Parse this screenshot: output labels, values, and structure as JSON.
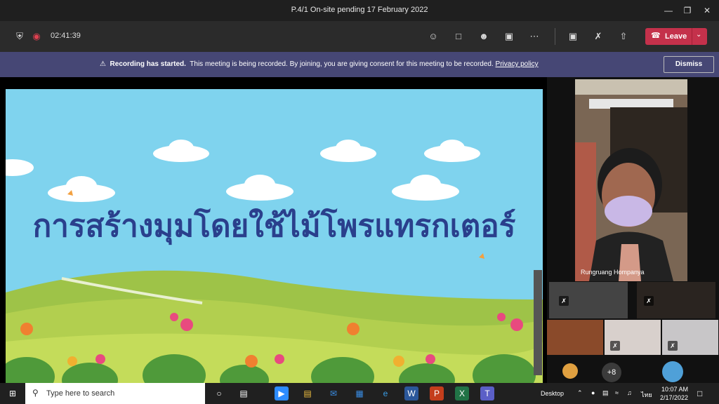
{
  "window": {
    "title": "P.4/1 On-site pending 17 February 2022"
  },
  "toolbar": {
    "timer": "02:41:39",
    "leave_label": "Leave",
    "icons": [
      "shield-icon",
      "record-icon",
      "people-icon",
      "chat-icon",
      "reactions-icon",
      "rooms-icon",
      "more-icon",
      "camera-off-icon",
      "mic-off-icon",
      "share-icon"
    ]
  },
  "banner": {
    "bold": "Recording has started.",
    "text": "This meeting is being recorded. By joining, you are giving consent for this meeting to be recorded.",
    "link": "Privacy policy",
    "dismiss_label": "Dismiss"
  },
  "slide": {
    "title": "การสร้างมุมโดยใช้ไม้โพรแทรกเตอร์"
  },
  "participants": {
    "speaker_name": "Rungruang Hompanya",
    "overflow_count": "+8"
  },
  "taskbar": {
    "search_placeholder": "Type here to search",
    "desktop_label": "Desktop",
    "lang": "ไทย",
    "time": "10:07 AM",
    "date": "2/17/2022"
  },
  "colors": {
    "leave": "#c4314b",
    "banner": "#464775",
    "slide_title": "#2a3f8c",
    "sky": "#7fd3ee"
  }
}
